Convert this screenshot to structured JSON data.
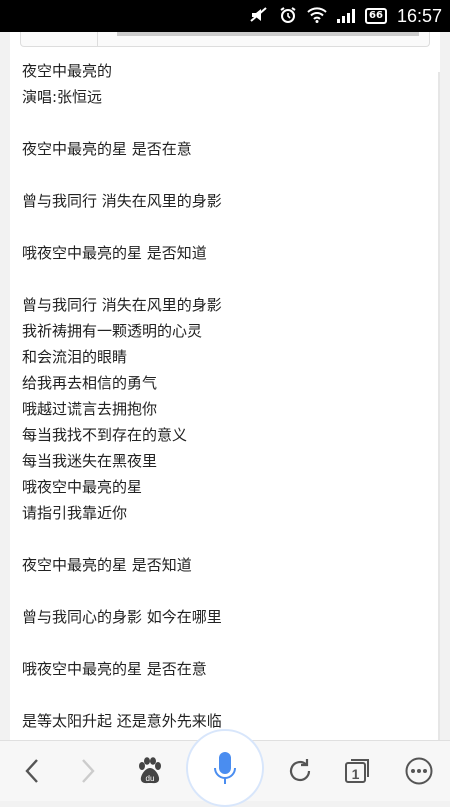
{
  "status_bar": {
    "time": "16:57",
    "battery": "66"
  },
  "lyrics": {
    "title": "夜空中最亮的",
    "singer": "演唱:张恒远",
    "lines": [
      "夜空中最亮的星 是否在意",
      "",
      "曾与我同行 消失在风里的身影",
      "",
      "哦夜空中最亮的星 是否知道",
      "",
      "曾与我同行 消失在风里的身影",
      "我祈祷拥有一颗透明的心灵",
      "和会流泪的眼睛",
      "给我再去相信的勇气",
      "哦越过谎言去拥抱你",
      "每当我找不到存在的意义",
      "每当我迷失在黑夜里",
      "哦夜空中最亮的星",
      "请指引我靠近你",
      "",
      "夜空中最亮的星 是否知道",
      "",
      "曾与我同心的身影 如今在哪里",
      "",
      "哦夜空中最亮的星 是否在意",
      "",
      "是等太阳升起 还是意外先来临"
    ]
  },
  "toolbar": {
    "tab_count": "1",
    "icons": [
      "back-icon",
      "forward-icon",
      "baidu-paw-icon",
      "microphone-icon",
      "refresh-icon",
      "tabs-icon",
      "more-icon"
    ],
    "accent_color": "#4a8df0"
  }
}
